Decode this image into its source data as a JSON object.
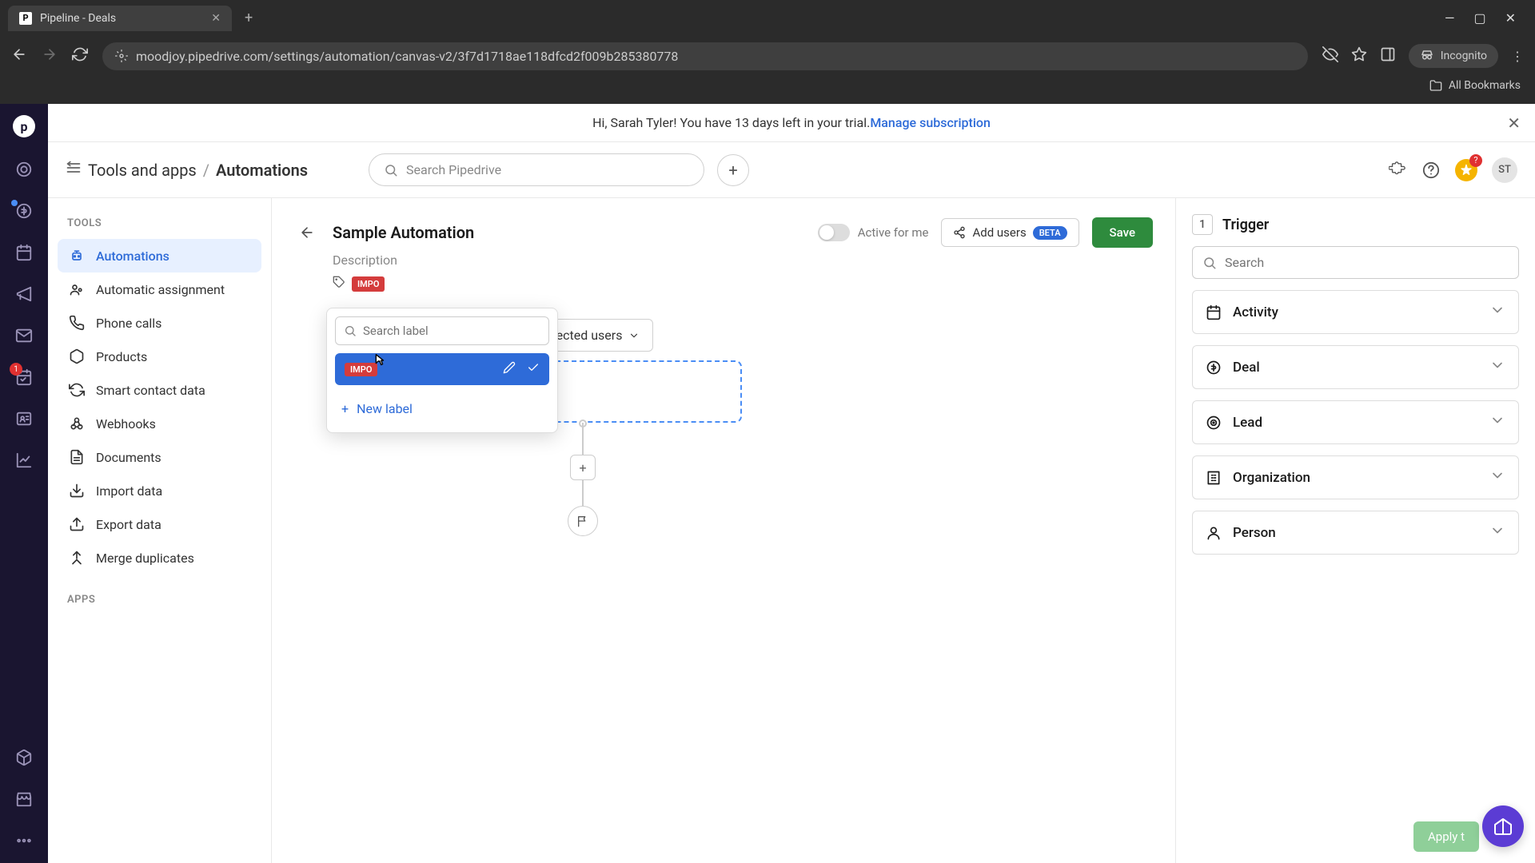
{
  "browser": {
    "tab_title": "Pipeline - Deals",
    "url": "moodjoy.pipedrive.com/settings/automation/canvas-v2/3f7d1718ae118dfcd2f009b285380778",
    "incognito": "Incognito",
    "all_bookmarks": "All Bookmarks"
  },
  "banner": {
    "text_prefix": "Hi, Sarah Tyler! You have 13 days left in your trial. ",
    "link": "Manage subscription"
  },
  "header": {
    "breadcrumb_root": "Tools and apps",
    "breadcrumb_sep": "/",
    "breadcrumb_current": "Automations",
    "search_placeholder": "Search Pipedrive",
    "avatar_initials": "ST"
  },
  "sidebar": {
    "section": "TOOLS",
    "items": [
      {
        "label": "Automations"
      },
      {
        "label": "Automatic assignment"
      },
      {
        "label": "Phone calls"
      },
      {
        "label": "Products"
      },
      {
        "label": "Smart contact data"
      },
      {
        "label": "Webhooks"
      },
      {
        "label": "Documents"
      },
      {
        "label": "Import data"
      },
      {
        "label": "Export data"
      },
      {
        "label": "Merge duplicates"
      }
    ],
    "apps_section": "APPS"
  },
  "page": {
    "title": "Sample Automation",
    "description": "Description",
    "active_label": "Active for me",
    "add_users": "Add users",
    "beta": "BETA",
    "save": "Save",
    "tag": "IMPO",
    "selected_users": "selected users"
  },
  "label_popup": {
    "search_placeholder": "Search label",
    "option_tag": "IMPO",
    "new_label": "New label"
  },
  "trigger": {
    "step": "1",
    "title": "Trigger",
    "search_placeholder": "Search",
    "items": [
      {
        "label": "Activity"
      },
      {
        "label": "Deal"
      },
      {
        "label": "Lead"
      },
      {
        "label": "Organization"
      },
      {
        "label": "Person"
      }
    ],
    "apply": "Apply t"
  },
  "rail_badge": "1"
}
